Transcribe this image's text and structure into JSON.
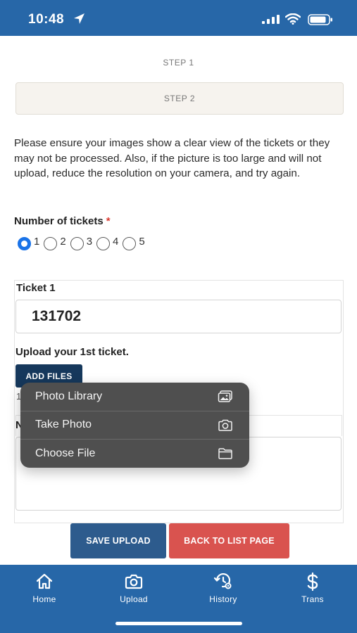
{
  "status_bar": {
    "time": "10:48"
  },
  "steps": {
    "step1": "STEP 1",
    "step2": "STEP 2"
  },
  "notice": "Please ensure your images show a clear view of the tickets or they may not be processed. Also, if the picture is too large and will not upload, reduce the resolution on your camera, and try again.",
  "tickets_count": {
    "label": "Number of tickets",
    "required_mark": "*",
    "options": [
      "1",
      "2",
      "3",
      "4",
      "5"
    ],
    "selected": "1"
  },
  "ticket": {
    "label": "Ticket 1",
    "value": "131702",
    "upload_label": "Upload your 1st ticket.",
    "add_files_label": "ADD FILES",
    "partial_count": "1",
    "notes_label_partial": "N"
  },
  "popup_menu": {
    "items": [
      {
        "label": "Photo Library",
        "icon": "photo-library-icon"
      },
      {
        "label": "Take Photo",
        "icon": "camera-icon"
      },
      {
        "label": "Choose File",
        "icon": "folder-icon"
      }
    ]
  },
  "actions": {
    "save_label": "SAVE UPLOAD",
    "back_label": "BACK TO LIST PAGE"
  },
  "bottom_nav": {
    "items": [
      {
        "label": "Home",
        "icon": "home-icon"
      },
      {
        "label": "Upload",
        "icon": "camera-icon"
      },
      {
        "label": "History",
        "icon": "history-icon"
      },
      {
        "label": "Trans",
        "icon": "dollar-icon"
      }
    ]
  },
  "colors": {
    "brand_blue": "#2767a8",
    "dark_button": "#16385c",
    "save_button": "#2d5b8d",
    "back_button": "#d9534f",
    "radio_selected": "#1a73e8",
    "required": "#d9392f"
  }
}
